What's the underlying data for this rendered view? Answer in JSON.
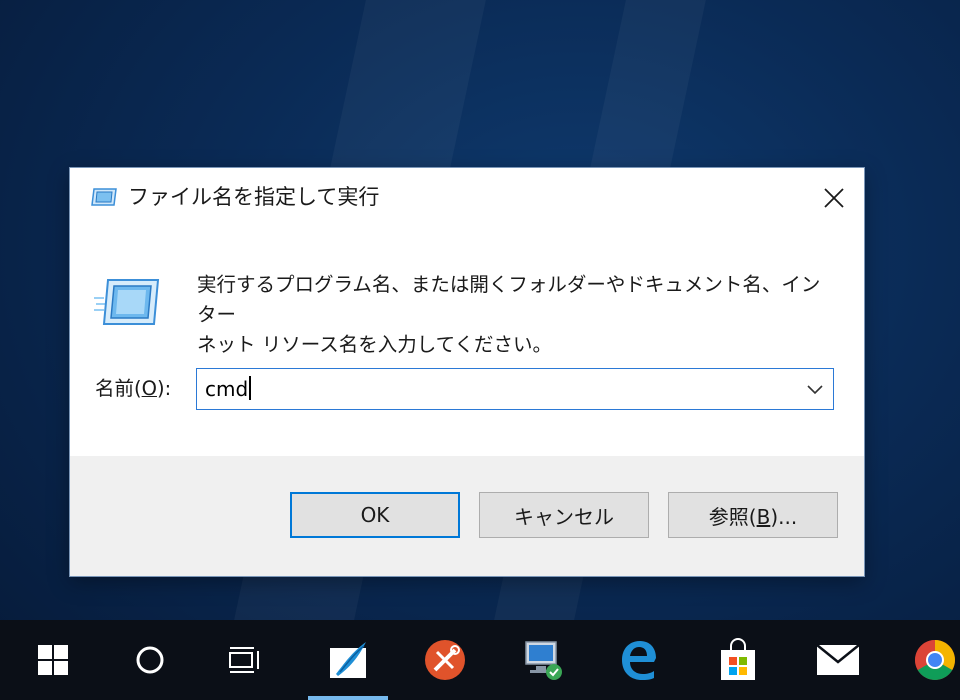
{
  "dialog": {
    "title": "ファイル名を指定して実行",
    "description_line1": "実行するプログラム名、または開くフォルダーやドキュメント名、インター",
    "description_line2": "ネット リソース名を入力してください。",
    "name_label_prefix": "名前(",
    "name_label_key": "O",
    "name_label_suffix": "):",
    "command_value": "cmd",
    "buttons": {
      "ok": "OK",
      "cancel": "キャンセル",
      "browse_prefix": "参照(",
      "browse_key": "B",
      "browse_suffix": ")..."
    }
  },
  "icons": {
    "title": "run-icon",
    "close": "close-icon",
    "dropdown": "chevron-down-icon"
  },
  "taskbar": {
    "items": [
      {
        "name": "start-button",
        "icon": "windows-logo-icon"
      },
      {
        "name": "search-button",
        "icon": "circle-icon"
      },
      {
        "name": "task-view-button",
        "icon": "task-view-icon"
      },
      {
        "name": "taskbar-app-feather",
        "icon": "feather-icon",
        "active": true
      },
      {
        "name": "taskbar-app-tools",
        "icon": "tools-icon"
      },
      {
        "name": "taskbar-app-network",
        "icon": "network-computer-icon"
      },
      {
        "name": "taskbar-app-edge",
        "icon": "edge-icon"
      },
      {
        "name": "taskbar-app-store",
        "icon": "store-icon"
      },
      {
        "name": "taskbar-app-mail",
        "icon": "mail-icon"
      },
      {
        "name": "taskbar-app-chrome",
        "icon": "chrome-icon"
      }
    ]
  },
  "colors": {
    "accent": "#0078d7",
    "field_border": "#2b79d6",
    "taskbar": "#0b0f17"
  }
}
